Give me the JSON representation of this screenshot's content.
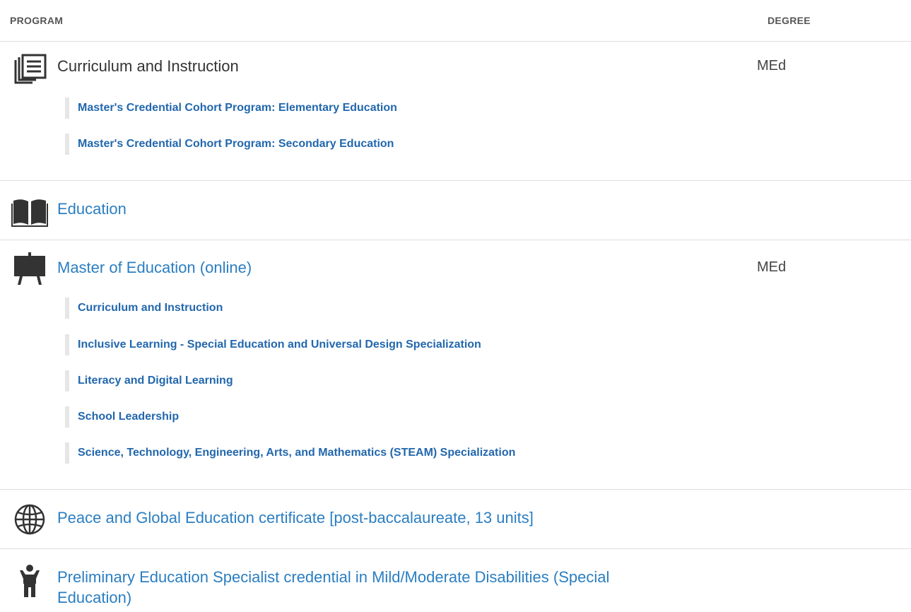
{
  "header": {
    "program_label": "PROGRAM",
    "degree_label": "DEGREE"
  },
  "programs": [
    {
      "title": "Curriculum and Instruction",
      "degree": "MEd",
      "icon": "document-stack-icon",
      "subs": [
        "Master's Credential Cohort Program: Elementary Education",
        "Master's Credential Cohort Program: Secondary Education"
      ]
    },
    {
      "title": "Education",
      "degree": "",
      "icon": "open-book-icon",
      "subs": []
    },
    {
      "title": "Master of Education (online)",
      "degree": "MEd",
      "icon": "easel-icon",
      "subs": [
        "Curriculum and Instruction",
        "Inclusive Learning - Special Education and Universal Design Specialization",
        "Literacy and Digital Learning",
        "School Leadership",
        "Science, Technology, Engineering, Arts, and Mathematics (STEAM) Specialization"
      ]
    },
    {
      "title": "Peace and Global Education certificate [post-baccalaureate, 13 units]",
      "degree": "",
      "icon": "globe-icon",
      "subs": []
    },
    {
      "title": "Preliminary Education Specialist credential in Mild/Moderate Disabilities (Special Education)",
      "degree": "",
      "icon": "person-icon",
      "subs": []
    }
  ],
  "colors": {
    "link": "#2b7ec1",
    "sub_link": "#2267ad",
    "divider": "#dedede",
    "sub_bar": "#e6e6e6"
  }
}
